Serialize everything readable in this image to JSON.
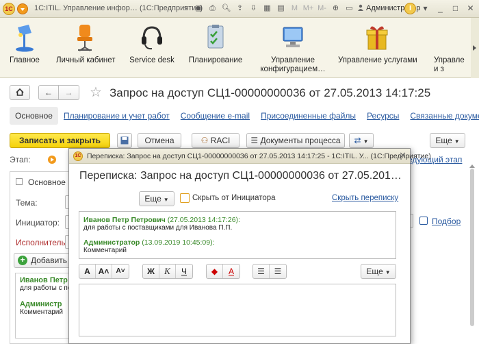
{
  "window": {
    "logo": "1С",
    "title": "1С:ITIL. Управление инфор… (1С:Предприятие)",
    "user": "Администратор",
    "info_icon": "i"
  },
  "toolbar_icons": [
    "home-icon",
    "save-icon",
    "print-icon",
    "preview-icon",
    "send-icon",
    "download-icon",
    "calendar-icon",
    "calc-icon",
    "m-icon",
    "m-plus-icon",
    "m-minus-icon",
    "zoom-icon"
  ],
  "sections": [
    {
      "label": "Главное",
      "icon": "lamp-icon"
    },
    {
      "label": "Личный кабинет",
      "icon": "chair-icon"
    },
    {
      "label": "Service desk",
      "icon": "headset-icon"
    },
    {
      "label": "Планирование",
      "icon": "clipboard-icon"
    },
    {
      "label": "Управление конфигурацием…",
      "icon": "computer-icon"
    },
    {
      "label": "Управление услугами",
      "icon": "gift-icon"
    },
    {
      "label": "Управле и з",
      "icon": "partial-icon"
    }
  ],
  "document": {
    "title": "Запрос на доступ СЦ1-00000000036 от 27.05.2013 14:17:25",
    "tabs": [
      "Основное",
      "Планирование и учет работ",
      "Сообщение e-mail",
      "Присоединенные файлы",
      "Ресурсы",
      "Связанные документы"
    ],
    "buttons": {
      "save_close": "Записать и закрыть",
      "cancel": "Отмена",
      "raci": "RACI",
      "process_docs": "Документы процесса",
      "more": "Еще"
    },
    "stage_label": "Этап:",
    "next_stage": "едующий этап",
    "main_tab": "Основное",
    "fields": {
      "theme": "Тема:",
      "initiator": "Инициатор:",
      "executor": "Исполнитель:"
    },
    "add_button": "Добавить",
    "podbor": "Подбор",
    "bg_messages": [
      {
        "author": "Иванов Петр",
        "text": "для работы с по"
      },
      {
        "author": "Администр",
        "text": "Комментарий"
      }
    ]
  },
  "dialog": {
    "logo": "1С",
    "window_title": "Переписка: Запрос на доступ СЦ1-00000000036 от 27.05.2013 14:17:25 - 1С:ITIL. У... (1С:Предприятие)",
    "heading": "Переписка: Запрос на доступ СЦ1-00000000036 от 27.05.201…",
    "more": "Еще",
    "hide_from_initiator": "Скрыть от Инициатора",
    "hide_correspondence": "Скрыть переписку",
    "messages": [
      {
        "author": "Иванов Петр Петрович",
        "date": "(27.05.2013 14:17:26):",
        "text": "для работы с поставщиками для Иванова П.П."
      },
      {
        "author": "Администратор",
        "date": "(13.09.2019 10:45:09):",
        "text": "Комментарий"
      }
    ],
    "format": {
      "font_a": "A",
      "font_up": "A˄",
      "font_down": "A˅",
      "bold": "Ж",
      "italic": "К",
      "underline": "Ч",
      "fill_color": "◆",
      "text_color": "A",
      "bullets": "☰",
      "numbered": "☰",
      "more": "Еще"
    },
    "editor_value": ""
  }
}
